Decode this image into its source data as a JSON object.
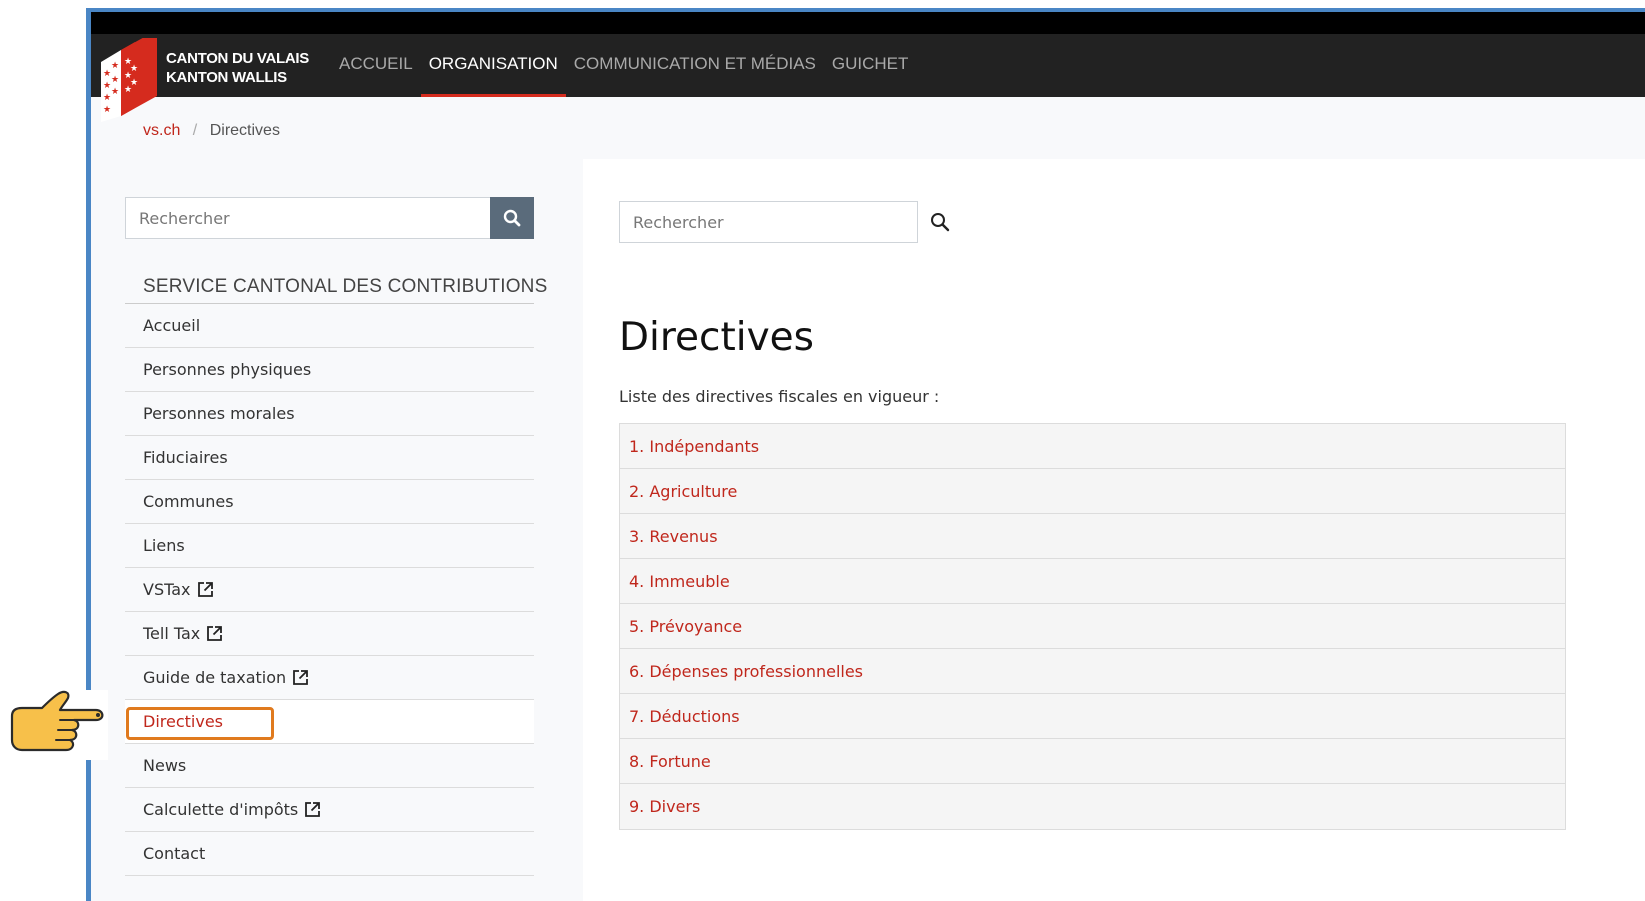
{
  "header": {
    "brand_line1": "CANTON DU VALAIS",
    "brand_line2": "KANTON WALLIS",
    "nav": [
      {
        "label": "ACCUEIL",
        "active": false
      },
      {
        "label": "ORGANISATION",
        "active": true
      },
      {
        "label": "COMMUNICATION ET MÉDIAS",
        "active": false
      },
      {
        "label": "GUICHET",
        "active": false
      }
    ],
    "colors": {
      "bar": "#222222",
      "accent": "#d52b1e"
    }
  },
  "breadcrumb": {
    "home": "vs.ch",
    "separator": "/",
    "current": "Directives"
  },
  "sidebar": {
    "search_placeholder": "Rechercher",
    "title": "SERVICE CANTONAL DES CONTRIBUTIONS",
    "items": [
      {
        "label": "Accueil",
        "external": false,
        "active": false
      },
      {
        "label": "Personnes physiques",
        "external": false,
        "active": false
      },
      {
        "label": "Personnes morales",
        "external": false,
        "active": false
      },
      {
        "label": "Fiduciaires",
        "external": false,
        "active": false
      },
      {
        "label": "Communes",
        "external": false,
        "active": false
      },
      {
        "label": "Liens",
        "external": false,
        "active": false
      },
      {
        "label": "VSTax",
        "external": true,
        "active": false
      },
      {
        "label": "Tell Tax",
        "external": true,
        "active": false
      },
      {
        "label": "Guide de taxation",
        "external": true,
        "active": false
      },
      {
        "label": "Directives",
        "external": false,
        "active": true
      },
      {
        "label": "News",
        "external": false,
        "active": false
      },
      {
        "label": "Calculette d'impôts",
        "external": true,
        "active": false
      },
      {
        "label": "Contact",
        "external": false,
        "active": false
      }
    ]
  },
  "main": {
    "search_placeholder": "Rechercher",
    "title": "Directives",
    "intro": "Liste des directives fiscales en vigueur :",
    "directives": [
      "1. Indépendants",
      "2. Agriculture",
      "3. Revenus",
      "4. Immeuble",
      "5. Prévoyance",
      "6. Dépenses professionnelles",
      "7. Déductions",
      "8. Fortune",
      "9. Divers"
    ]
  },
  "icons": {
    "search": "search-icon",
    "external": "external-link-icon",
    "pointer": "pointing-hand-icon",
    "logo": "valais-flag-logo"
  }
}
